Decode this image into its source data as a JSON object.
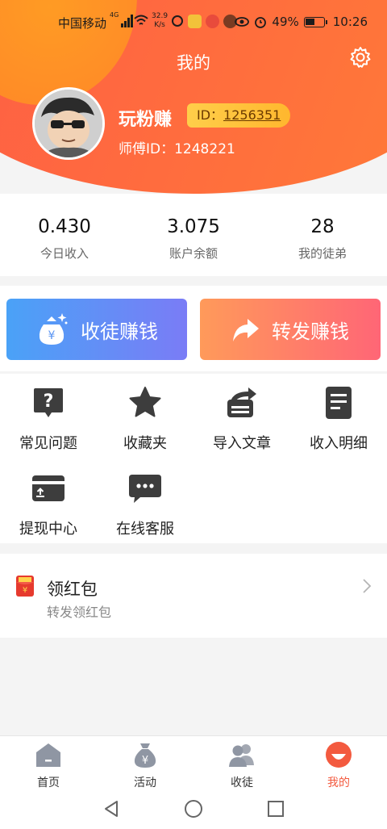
{
  "status_bar": {
    "carrier": "中国移动",
    "net_type": "4G",
    "speed_value": "32.9",
    "speed_unit": "K/s",
    "battery": "49%",
    "time": "10:26"
  },
  "header": {
    "title": "我的",
    "settings_icon": "gear-icon"
  },
  "profile": {
    "nickname": "玩粉赚",
    "id_label": "ID：",
    "id_value": "1256351",
    "master_label": "师傅ID：",
    "master_id": "1248221"
  },
  "stats": [
    {
      "value": "0.430",
      "label": "今日收入"
    },
    {
      "value": "3.075",
      "label": "账户余额"
    },
    {
      "value": "28",
      "label": "我的徒弟"
    }
  ],
  "actions": {
    "recruit_label": "收徒赚钱",
    "share_label": "转发赚钱"
  },
  "menu": [
    {
      "label": "常见问题",
      "icon": "question-icon"
    },
    {
      "label": "收藏夹",
      "icon": "star-icon"
    },
    {
      "label": "导入文章",
      "icon": "import-icon"
    },
    {
      "label": "收入明细",
      "icon": "document-icon"
    },
    {
      "label": "提现中心",
      "icon": "card-icon"
    },
    {
      "label": "在线客服",
      "icon": "chat-icon"
    }
  ],
  "red_packet": {
    "title": "领红包",
    "subtitle": "转发领红包"
  },
  "tabs": [
    {
      "label": "首页",
      "icon": "home-icon",
      "active": false
    },
    {
      "label": "活动",
      "icon": "money-bag-icon",
      "active": false
    },
    {
      "label": "收徒",
      "icon": "users-icon",
      "active": false
    },
    {
      "label": "我的",
      "icon": "profile-icon",
      "active": true
    }
  ],
  "colors": {
    "header_orange": "#ff6a3f",
    "accent_red": "#f35a3f",
    "badge_gold": "#ffc13b",
    "recruit_blue": "#4aa2f7",
    "share_pink": "#ff6676",
    "icon_dark": "#3d3d3d"
  }
}
